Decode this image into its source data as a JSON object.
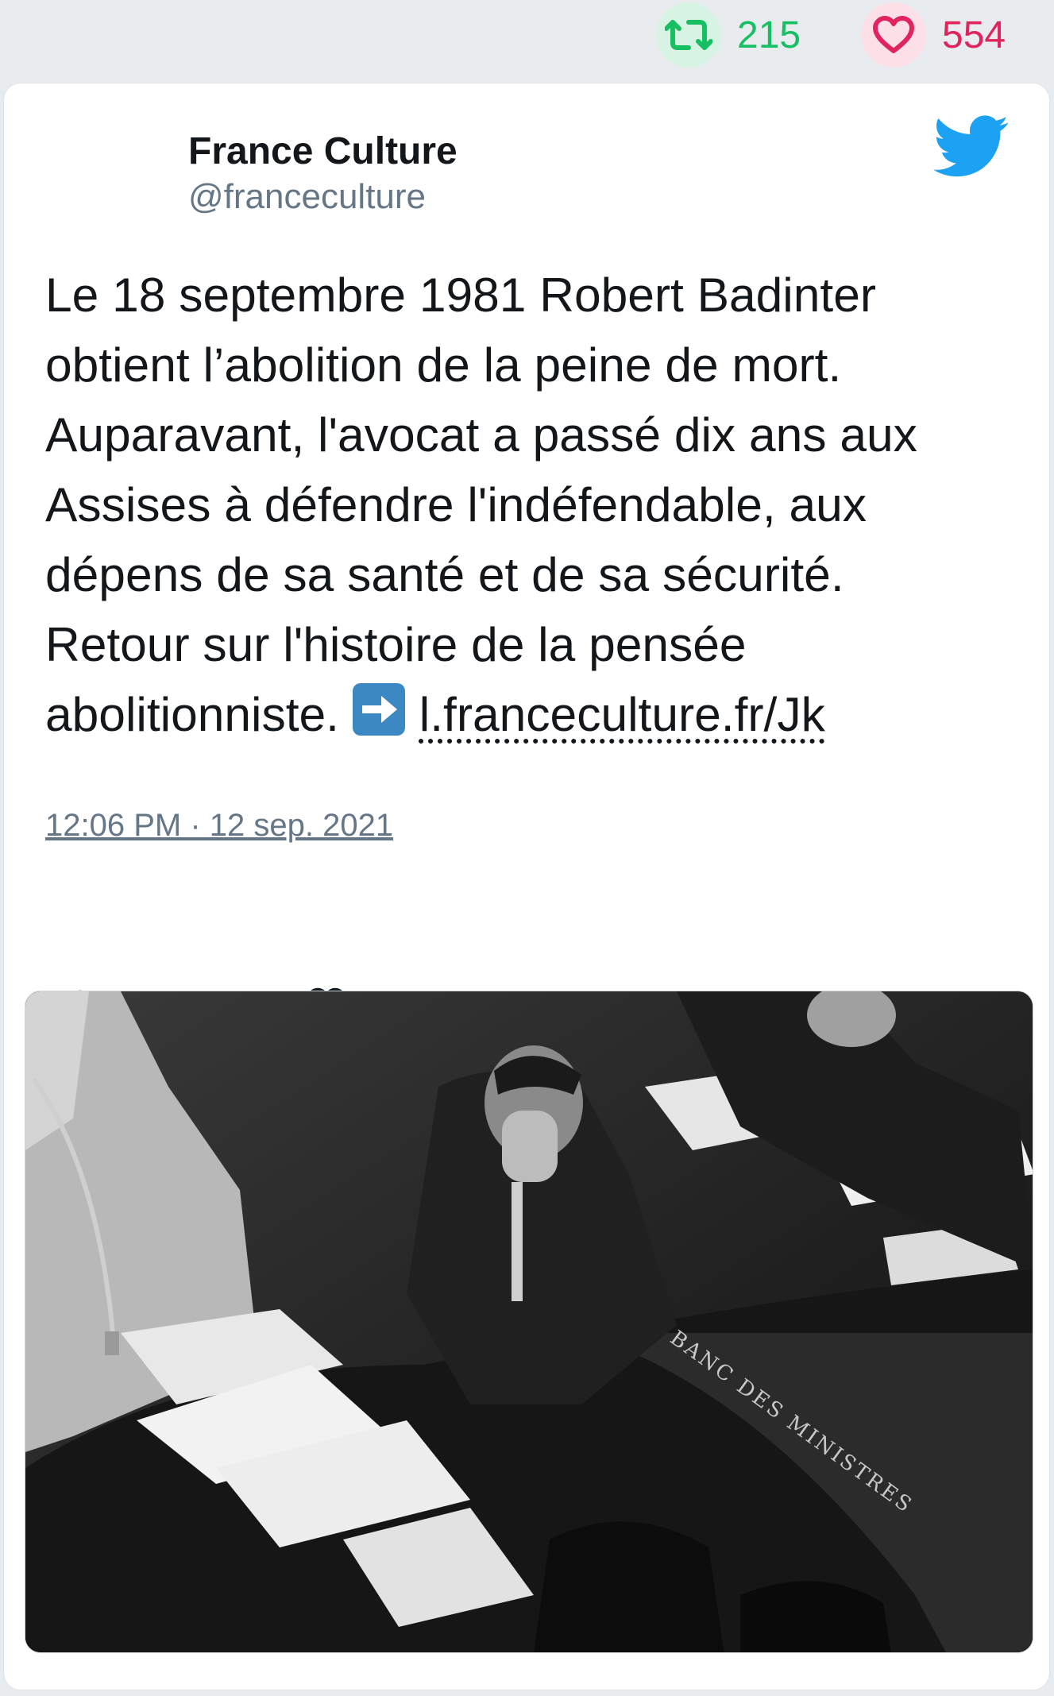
{
  "stats": {
    "retweets": "215",
    "likes": "554",
    "retweet_icon": "retweet-icon",
    "like_icon": "heart-icon",
    "retweet_color": "#17bf63",
    "like_color": "#e0245e"
  },
  "tweet": {
    "author_name": "France Culture",
    "author_handle": "@franceculture",
    "text_lines": [
      "Le 18 septembre 1981 Robert Badinter",
      "obtient l’abolition de la peine de mort.",
      "Auparavant, l'avocat a passé dix ans aux",
      "Assises à défendre l'indéfendable, aux",
      "dépens de sa santé et de sa sécurité.",
      "Retour sur l'histoire de la pensée",
      "abolitionniste."
    ],
    "link_text": "l.franceculture.fr/Jk",
    "timestamp": "12:06 PM · 12 sep. 2021",
    "brand_color": "#1da1f2",
    "photo_inscription": "BANC DES MINISTRES"
  }
}
